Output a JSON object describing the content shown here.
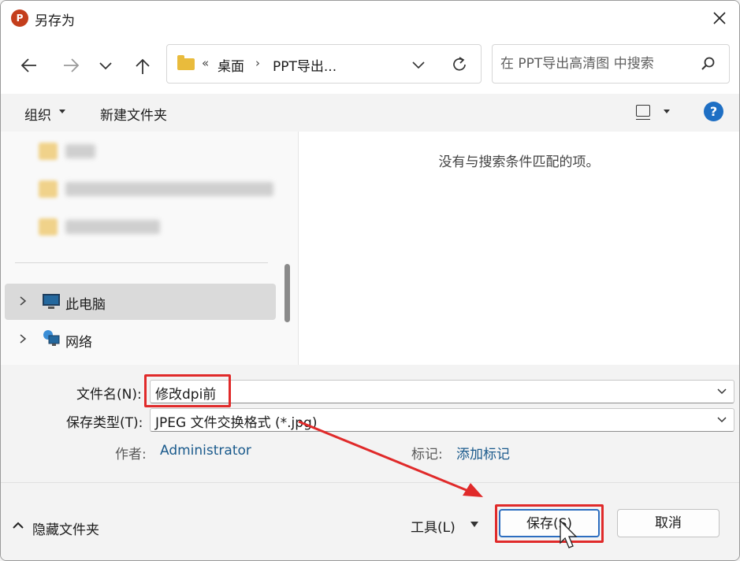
{
  "window": {
    "title": "另存为",
    "app_icon_letter": "P"
  },
  "address_bar": {
    "overflow": "«",
    "breadcrumbs": [
      "桌面",
      "PPT导出..."
    ],
    "separator": "›"
  },
  "search": {
    "placeholder": "在 PPT导出高清图 中搜索"
  },
  "toolbar": {
    "organize_label": "组织",
    "new_folder_label": "新建文件夹"
  },
  "nav_pane": {
    "items": [
      {
        "label": "此电脑",
        "selected": true
      },
      {
        "label": "网络",
        "selected": false
      }
    ]
  },
  "content": {
    "empty_message": "没有与搜索条件匹配的项。"
  },
  "form": {
    "filename_label": "文件名(N):",
    "filename_value": "修改dpi前",
    "filetype_label": "保存类型(T):",
    "filetype_value": "JPEG 文件交换格式 (*.jpg)",
    "author_label": "作者:",
    "author_value": "Administrator",
    "tags_label": "标记:",
    "tags_value": "添加标记"
  },
  "footer": {
    "hide_folders_label": "隐藏文件夹",
    "tools_label": "工具(L)",
    "save_label": "保存(S)",
    "cancel_label": "取消"
  },
  "annotation_color": "#e02a2a",
  "accent_color": "#2d6ec0"
}
